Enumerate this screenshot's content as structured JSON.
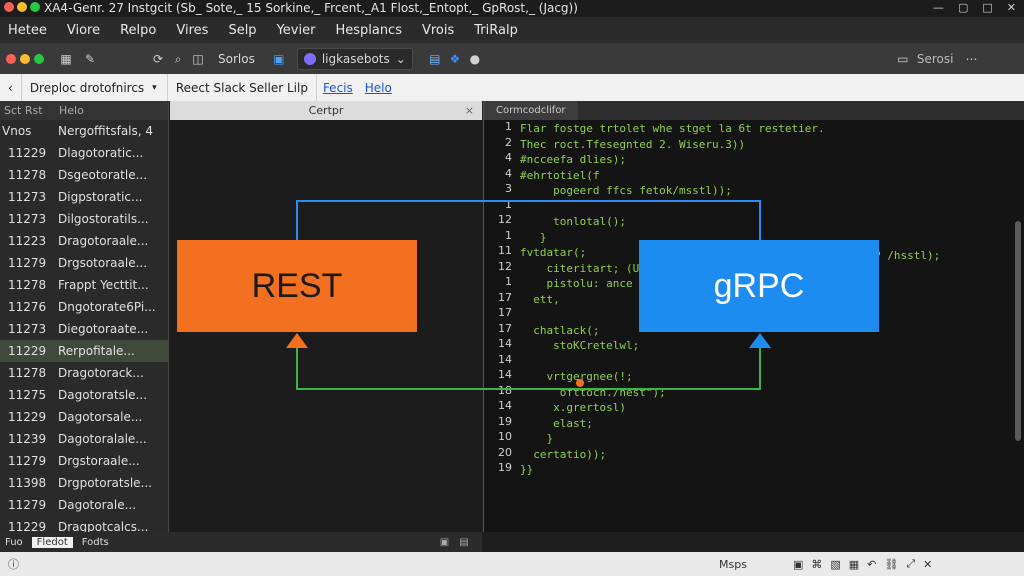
{
  "window": {
    "title": "XA4-Genr. 27 Instgcit (Sb_ Sote,_ 15 Sorkine,_ Frcent,_A1 Flost,_Entopt,_ GpRost,_ (Jacg))",
    "traffic_colors": [
      "#ff5f57",
      "#febc2e",
      "#28c840"
    ],
    "controls": [
      "minimize-icon",
      "restore-icon",
      "square-icon",
      "close-icon"
    ]
  },
  "menu": [
    "Hetee",
    "Viore",
    "Relpo",
    "Vires",
    "Selp",
    "Yevier",
    "Hesplancs",
    "Vrois",
    "TriRalp"
  ],
  "toolbar": {
    "dots": [
      "#ff5f57",
      "#febc2e",
      "#28c840"
    ],
    "sorlos": "Sorlos",
    "branch": "ligkasebots",
    "right_label": "Serosi"
  },
  "breadcrumb": {
    "back_icon": "chevron-left-icon",
    "path": "Dreploc drotofnircs",
    "path_caret": "▾",
    "context": "Reect Slack Seller Lilp",
    "links": [
      "Fecis",
      "Helo"
    ]
  },
  "left_panel": {
    "header": [
      "Sct Rst",
      "Helo"
    ],
    "first_row": {
      "id": "Vnos",
      "name": "Nergoffitsfals, 4"
    },
    "rows": [
      {
        "id": "11229",
        "name": "Dlagotoratic..."
      },
      {
        "id": "11278",
        "name": "Dsgeotoratle..."
      },
      {
        "id": "11273",
        "name": "Digpstoratic..."
      },
      {
        "id": "11273",
        "name": "Dilgostoratils..."
      },
      {
        "id": "11223",
        "name": "Dragotoraale..."
      },
      {
        "id": "11279",
        "name": "Drgsotoraale..."
      },
      {
        "id": "11278",
        "name": "Frappt Yecttit..."
      },
      {
        "id": "11276",
        "name": "Dngotorate6Pi..."
      },
      {
        "id": "11273",
        "name": "Diegotoraate..."
      },
      {
        "id": "11229",
        "name": "Rerpofitale...",
        "selected": true
      },
      {
        "id": "11278",
        "name": "Dragotorack..."
      },
      {
        "id": "11275",
        "name": "Dagotoratsle..."
      },
      {
        "id": "11229",
        "name": "Dagotorsale..."
      },
      {
        "id": "11239",
        "name": "Dagotoralale..."
      },
      {
        "id": "11279",
        "name": "Drgstoraale..."
      },
      {
        "id": "11398",
        "name": "Drgpotoratsle..."
      },
      {
        "id": "11279",
        "name": "Dagotorale..."
      },
      {
        "id": "11229",
        "name": "Dragpotcalcs..."
      }
    ]
  },
  "center_panel": {
    "tab": "Certpr",
    "close": "×"
  },
  "editor": {
    "tab": "Cormcodclifor",
    "line_numbers": [
      "1",
      "2",
      "4",
      "4",
      "3",
      "1",
      "12",
      "1",
      "11",
      "12",
      "1",
      "17",
      "17",
      "17",
      "14",
      "14",
      "14",
      "18",
      "14",
      "19",
      "10",
      "20",
      "19"
    ],
    "lines": [
      "Flar fostge trtolet whe stget la 6t restetier.",
      "Thec roct.Tfesegnted 2. Wiseru.3))",
      "#ncceefa dlies);",
      "#ehrtotiel(f",
      "     pogeerd ffcs fetok/msstl));",
      "",
      "     tonlotal();",
      "   }",
      "fvtdatar(;",
      "    citeritart; (U",
      "    pistolu: ance",
      "  ett,",
      "",
      "  chatlack(;",
      "     stoKCretelwl;",
      "",
      "    vrtgergnee(!;",
      "      ofttoch./hest\");",
      "     x.grertosl)",
      "     elast;",
      "    }",
      "  certatio));",
      "}}"
    ],
    "overflow_text": "P /hsstl);"
  },
  "bottom_tabs": [
    "Fuo",
    "Fledot",
    "Fodts"
  ],
  "statusbar": {
    "left_icon": "info-icon",
    "label": "Msps",
    "icons": [
      "save-icon",
      "code-icon",
      "image-icon",
      "grid-icon",
      "undo-icon",
      "link-icon",
      "fullscreen-icon",
      "close-icon"
    ]
  },
  "diagram": {
    "rest_label": "REST",
    "grpc_label": "gRPC",
    "colors": {
      "rest": "#f37021",
      "grpc": "#1c8cf0",
      "top_line": "#2d8cf0",
      "bottom_line": "#3ab54a"
    }
  }
}
